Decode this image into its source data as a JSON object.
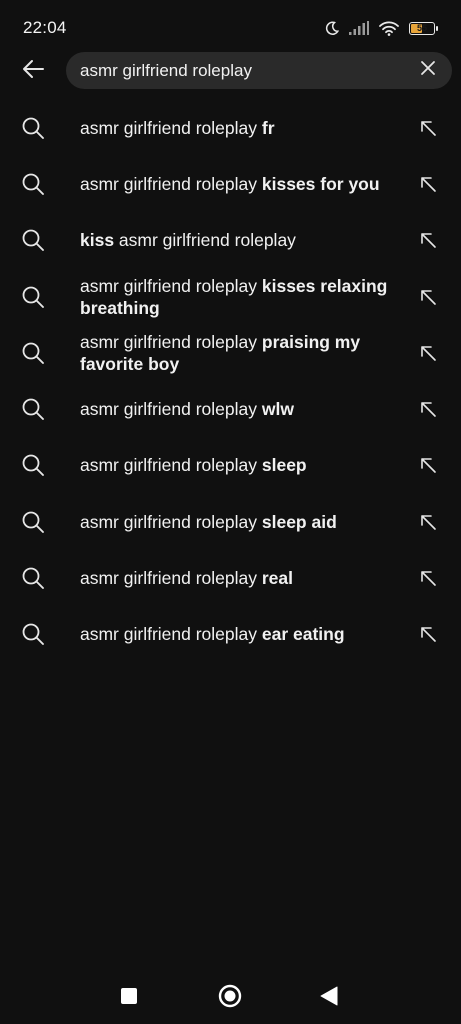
{
  "status_bar": {
    "time": "22:04",
    "battery_level": "55",
    "battery_fraction": 0.55,
    "battery_color": "#e8a53a",
    "icons": [
      "moon-icon",
      "signal-icon",
      "wifi-icon",
      "battery-icon"
    ]
  },
  "search": {
    "query": "asmr girlfriend roleplay",
    "back_icon": "arrow-left-icon",
    "clear_icon": "close-icon"
  },
  "suggestions": [
    {
      "prefix": "asmr girlfriend roleplay ",
      "bold": "fr",
      "suffix": ""
    },
    {
      "prefix": "asmr girlfriend roleplay ",
      "bold": "kisses for you",
      "suffix": ""
    },
    {
      "prefix": "",
      "bold": "kiss",
      "suffix": " asmr girlfriend roleplay"
    },
    {
      "prefix": "asmr girlfriend roleplay ",
      "bold": "kisses relaxing breathing",
      "suffix": ""
    },
    {
      "prefix": "asmr girlfriend roleplay ",
      "bold": "praising my favorite boy",
      "suffix": ""
    },
    {
      "prefix": "asmr girlfriend roleplay ",
      "bold": "wlw",
      "suffix": ""
    },
    {
      "prefix": "asmr girlfriend roleplay ",
      "bold": "sleep",
      "suffix": ""
    },
    {
      "prefix": "asmr girlfriend roleplay ",
      "bold": "sleep aid",
      "suffix": ""
    },
    {
      "prefix": "asmr girlfriend roleplay ",
      "bold": "real",
      "suffix": ""
    },
    {
      "prefix": "asmr girlfriend roleplay ",
      "bold": "ear eating",
      "suffix": ""
    }
  ],
  "nav_bar": {
    "buttons": [
      "square-recents-icon",
      "circle-home-icon",
      "triangle-back-icon"
    ]
  },
  "colors": {
    "background": "#101010",
    "search_box": "#2a2a2a",
    "text": "#f1f1f1",
    "icon": "#e6e6e6"
  }
}
